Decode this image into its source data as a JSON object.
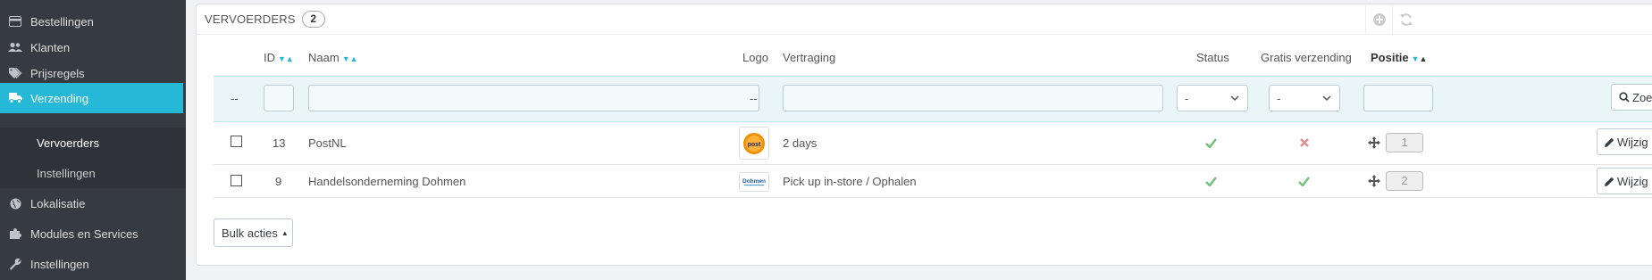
{
  "sidebar": {
    "items": [
      {
        "label": "Bestellingen",
        "icon": "credit-card-icon"
      },
      {
        "label": "Klanten",
        "icon": "users-icon"
      },
      {
        "label": "Prijsregels",
        "icon": "tags-icon"
      },
      {
        "label": "Verzending",
        "icon": "truck-icon",
        "active": true
      },
      {
        "label": "Lokalisatie",
        "icon": "globe-icon"
      },
      {
        "label": "Modules en Services",
        "icon": "puzzle-icon"
      },
      {
        "label": "Instellingen",
        "icon": "wrench-icon"
      }
    ],
    "subitems": [
      {
        "label": "Vervoerders",
        "current": true
      },
      {
        "label": "Instellingen"
      }
    ]
  },
  "panel": {
    "title": "VERVOERDERS",
    "count": "2"
  },
  "table": {
    "headers": {
      "id": "ID",
      "name": "Naam",
      "logo": "Logo",
      "delay": "Vertraging",
      "status": "Status",
      "free_shipping": "Gratis verzending",
      "position": "Positie"
    },
    "filter": {
      "id_dash": "--",
      "logo_dash": "--",
      "status_select": "-",
      "free_select": "-",
      "search_label": "Zoek"
    },
    "rows": [
      {
        "id": "13",
        "name": "PostNL",
        "logo": "postnl-logo",
        "delay": "2 days",
        "status": true,
        "free_shipping": false,
        "position": "1",
        "edit_label": "Wijzig"
      },
      {
        "id": "9",
        "name": "Handelsonderneming Dohmen",
        "logo": "dohmen-logo",
        "delay": "Pick up in-store / Ophalen",
        "status": true,
        "free_shipping": true,
        "position": "2",
        "edit_label": "Wijzig"
      }
    ]
  },
  "bulk_actions_label": "Bulk acties",
  "colors": {
    "sidebar_bg": "#363a41",
    "accent": "#25b9d7",
    "check_green": "#72c279",
    "cross_red": "#e08f95",
    "postnl_orange": "#f29000"
  }
}
